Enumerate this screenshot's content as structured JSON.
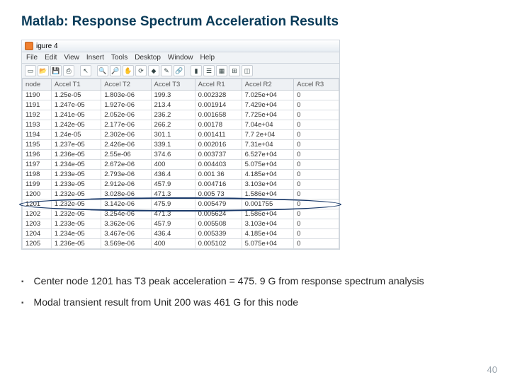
{
  "slide": {
    "title": "Matlab: Response Spectrum Acceleration Results",
    "page_number": "40"
  },
  "figure": {
    "window_label": "igure 4",
    "menu": [
      "File",
      "Edit",
      "View",
      "Insert",
      "Tools",
      "Desktop",
      "Window",
      "Help"
    ],
    "toolbar_icons": [
      "new-file",
      "open",
      "save",
      "print",
      "arrow",
      "zoom-in",
      "zoom-out",
      "pan",
      "rotate",
      "data-cursor",
      "brush",
      "link",
      "colorbar",
      "legend",
      "hide",
      "grid",
      "axes"
    ],
    "columns": [
      "node",
      "Accel T1",
      "Accel T2",
      "Accel T3",
      "Accel R1",
      "Accel R2",
      "Accel R3"
    ],
    "rows": [
      {
        "node": "1190",
        "t1": "1.25e-05",
        "t2": "1.803e-06",
        "t3": "199.3",
        "r1": "0.002328",
        "r2": "7.025e+04",
        "r3": "0"
      },
      {
        "node": "1191",
        "t1": "1.247e-05",
        "t2": "1.927e-06",
        "t3": "213.4",
        "r1": "0.001914",
        "r2": "7.429e+04",
        "r3": "0"
      },
      {
        "node": "1192",
        "t1": "1.241e-05",
        "t2": "2.052e-06",
        "t3": "236.2",
        "r1": "0.001658",
        "r2": "7.725e+04",
        "r3": "0"
      },
      {
        "node": "1193",
        "t1": "1.242e-05",
        "t2": "2.177e-06",
        "t3": "266.2",
        "r1": "0.00178",
        "r2": "7.04e+04",
        "r3": "0"
      },
      {
        "node": "1194",
        "t1": "1.24e-05",
        "t2": "2.302e-06",
        "t3": "301.1",
        "r1": "0.001411",
        "r2": "7.7 2e+04",
        "r3": "0"
      },
      {
        "node": "1195",
        "t1": "1.237e-05",
        "t2": "2.426e-06",
        "t3": "339.1",
        "r1": "0.002016",
        "r2": "7.31e+04",
        "r3": "0"
      },
      {
        "node": "1196",
        "t1": "1.236e-05",
        "t2": "2.55e-06",
        "t3": "374.6",
        "r1": "0.003737",
        "r2": "6.527e+04",
        "r3": "0"
      },
      {
        "node": "1197",
        "t1": "1.234e-05",
        "t2": "2.672e-06",
        "t3": "400",
        "r1": "0.004403",
        "r2": "5.075e+04",
        "r3": "0"
      },
      {
        "node": "1198",
        "t1": "1.233e-05",
        "t2": "2.793e-06",
        "t3": "436.4",
        "r1": "0.001 36",
        "r2": "4.185e+04",
        "r3": "0"
      },
      {
        "node": "1199",
        "t1": "1.233e-05",
        "t2": "2.912e-06",
        "t3": "457.9",
        "r1": "0.004716",
        "r2": "3.103e+04",
        "r3": "0"
      },
      {
        "node": "1200",
        "t1": "1.232e-05",
        "t2": "3.028e-06",
        "t3": "471.3",
        "r1": "0.005 73",
        "r2": "1.586e+04",
        "r3": "0"
      },
      {
        "node": "1201",
        "t1": "1.232e-05",
        "t2": "3.142e-06",
        "t3": "475.9",
        "r1": "0.005479",
        "r2": "0.001755",
        "r3": "0"
      },
      {
        "node": "1202",
        "t1": "1.232e-05",
        "t2": "3.254e-06",
        "t3": "471.3",
        "r1": "0.005624",
        "r2": "1.586e+04",
        "r3": "0"
      },
      {
        "node": "1203",
        "t1": "1.233e-05",
        "t2": "3.362e-06",
        "t3": "457.9",
        "r1": "0.005508",
        "r2": "3.103e+04",
        "r3": "0"
      },
      {
        "node": "1204",
        "t1": "1.234e-05",
        "t2": "3.467e-06",
        "t3": "436.4",
        "r1": "0.005339",
        "r2": "4.185e+04",
        "r3": "0"
      },
      {
        "node": "1205",
        "t1": "1.236e-05",
        "t2": "3.569e-06",
        "t3": "400",
        "r1": "0.005102",
        "r2": "5.075e+04",
        "r3": "0"
      }
    ],
    "highlight_node": "1201"
  },
  "bullets": [
    "Center node 1201 has T3 peak acceleration = 475. 9 G from response spectrum analysis",
    "Modal transient result from Unit 200 was 461 G for this node"
  ]
}
